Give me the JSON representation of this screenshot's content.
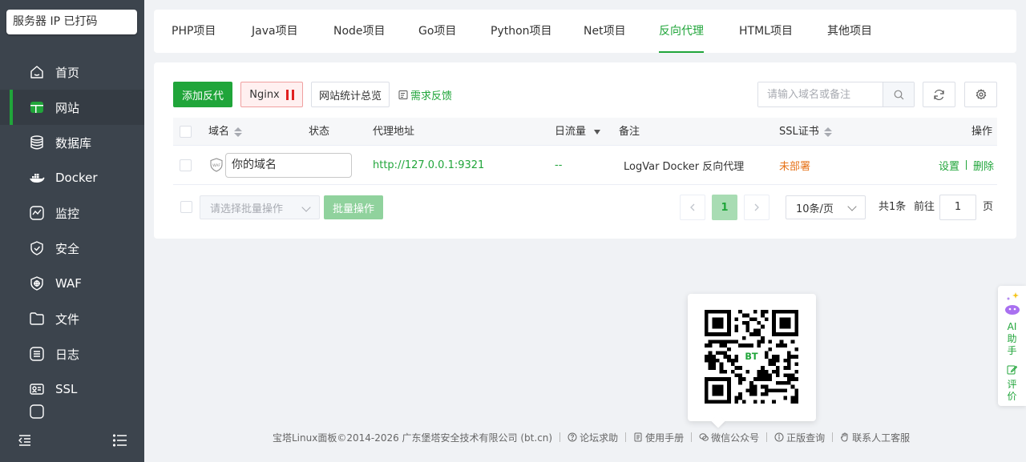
{
  "sidebar": {
    "server_label": "服务器 IP 已打码",
    "items": [
      {
        "label": "首页",
        "icon": "home-icon"
      },
      {
        "label": "网站",
        "icon": "website-icon",
        "active": true
      },
      {
        "label": "数据库",
        "icon": "database-icon"
      },
      {
        "label": "Docker",
        "icon": "docker-icon"
      },
      {
        "label": "监控",
        "icon": "monitor-icon"
      },
      {
        "label": "安全",
        "icon": "shield-check-icon"
      },
      {
        "label": "WAF",
        "icon": "waf-shield-icon"
      },
      {
        "label": "文件",
        "icon": "folder-icon"
      },
      {
        "label": "日志",
        "icon": "log-icon"
      },
      {
        "label": "SSL",
        "icon": "ssl-icon"
      }
    ]
  },
  "tabs": [
    "PHP项目",
    "Java项目",
    "Node项目",
    "Go项目",
    "Python项目",
    "Net项目",
    "反向代理",
    "HTML项目",
    "其他项目"
  ],
  "active_tab": "反向代理",
  "toolbar": {
    "add_label": "添加反代",
    "nginx_label": "Nginx",
    "stats_label": "网站统计总览",
    "feedback_label": "需求反馈",
    "search_placeholder": "请输入域名或备注"
  },
  "table": {
    "headers": {
      "domain": "域名",
      "status": "状态",
      "proxy": "代理地址",
      "traffic": "日流量",
      "remark": "备注",
      "ssl": "SSL证书",
      "ops": "操作"
    },
    "rows": [
      {
        "domain": "你的域名",
        "proxy": "http://127.0.0.1:9321",
        "traffic": "--",
        "remark": "LogVar Docker 反向代理",
        "ssl": "未部署",
        "op_settings": "设置",
        "op_delete": "删除"
      }
    ]
  },
  "batch": {
    "select_placeholder": "请选择批量操作",
    "button_label": "批量操作"
  },
  "pagination": {
    "current_page": "1",
    "page_size": "10条/页",
    "total": "共1条",
    "goto_label": "前往",
    "goto_value": "1",
    "page_unit": "页"
  },
  "footer": {
    "copyright": "宝塔Linux面板©2014-2026 广东堡塔安全技术有限公司 (bt.cn)",
    "links": [
      "论坛求助",
      "使用手册",
      "微信公众号",
      "正版查询",
      "联系人工客服"
    ]
  },
  "qr": {
    "center_text": "BT"
  },
  "ai_float": {
    "ai_label": "AI",
    "assistant_label": "助手",
    "review_label": "评价"
  },
  "colors": {
    "brand": "#20a53a",
    "sidebar_bg": "#3c444d",
    "warning": "#e6731a",
    "danger": "#e02020"
  }
}
